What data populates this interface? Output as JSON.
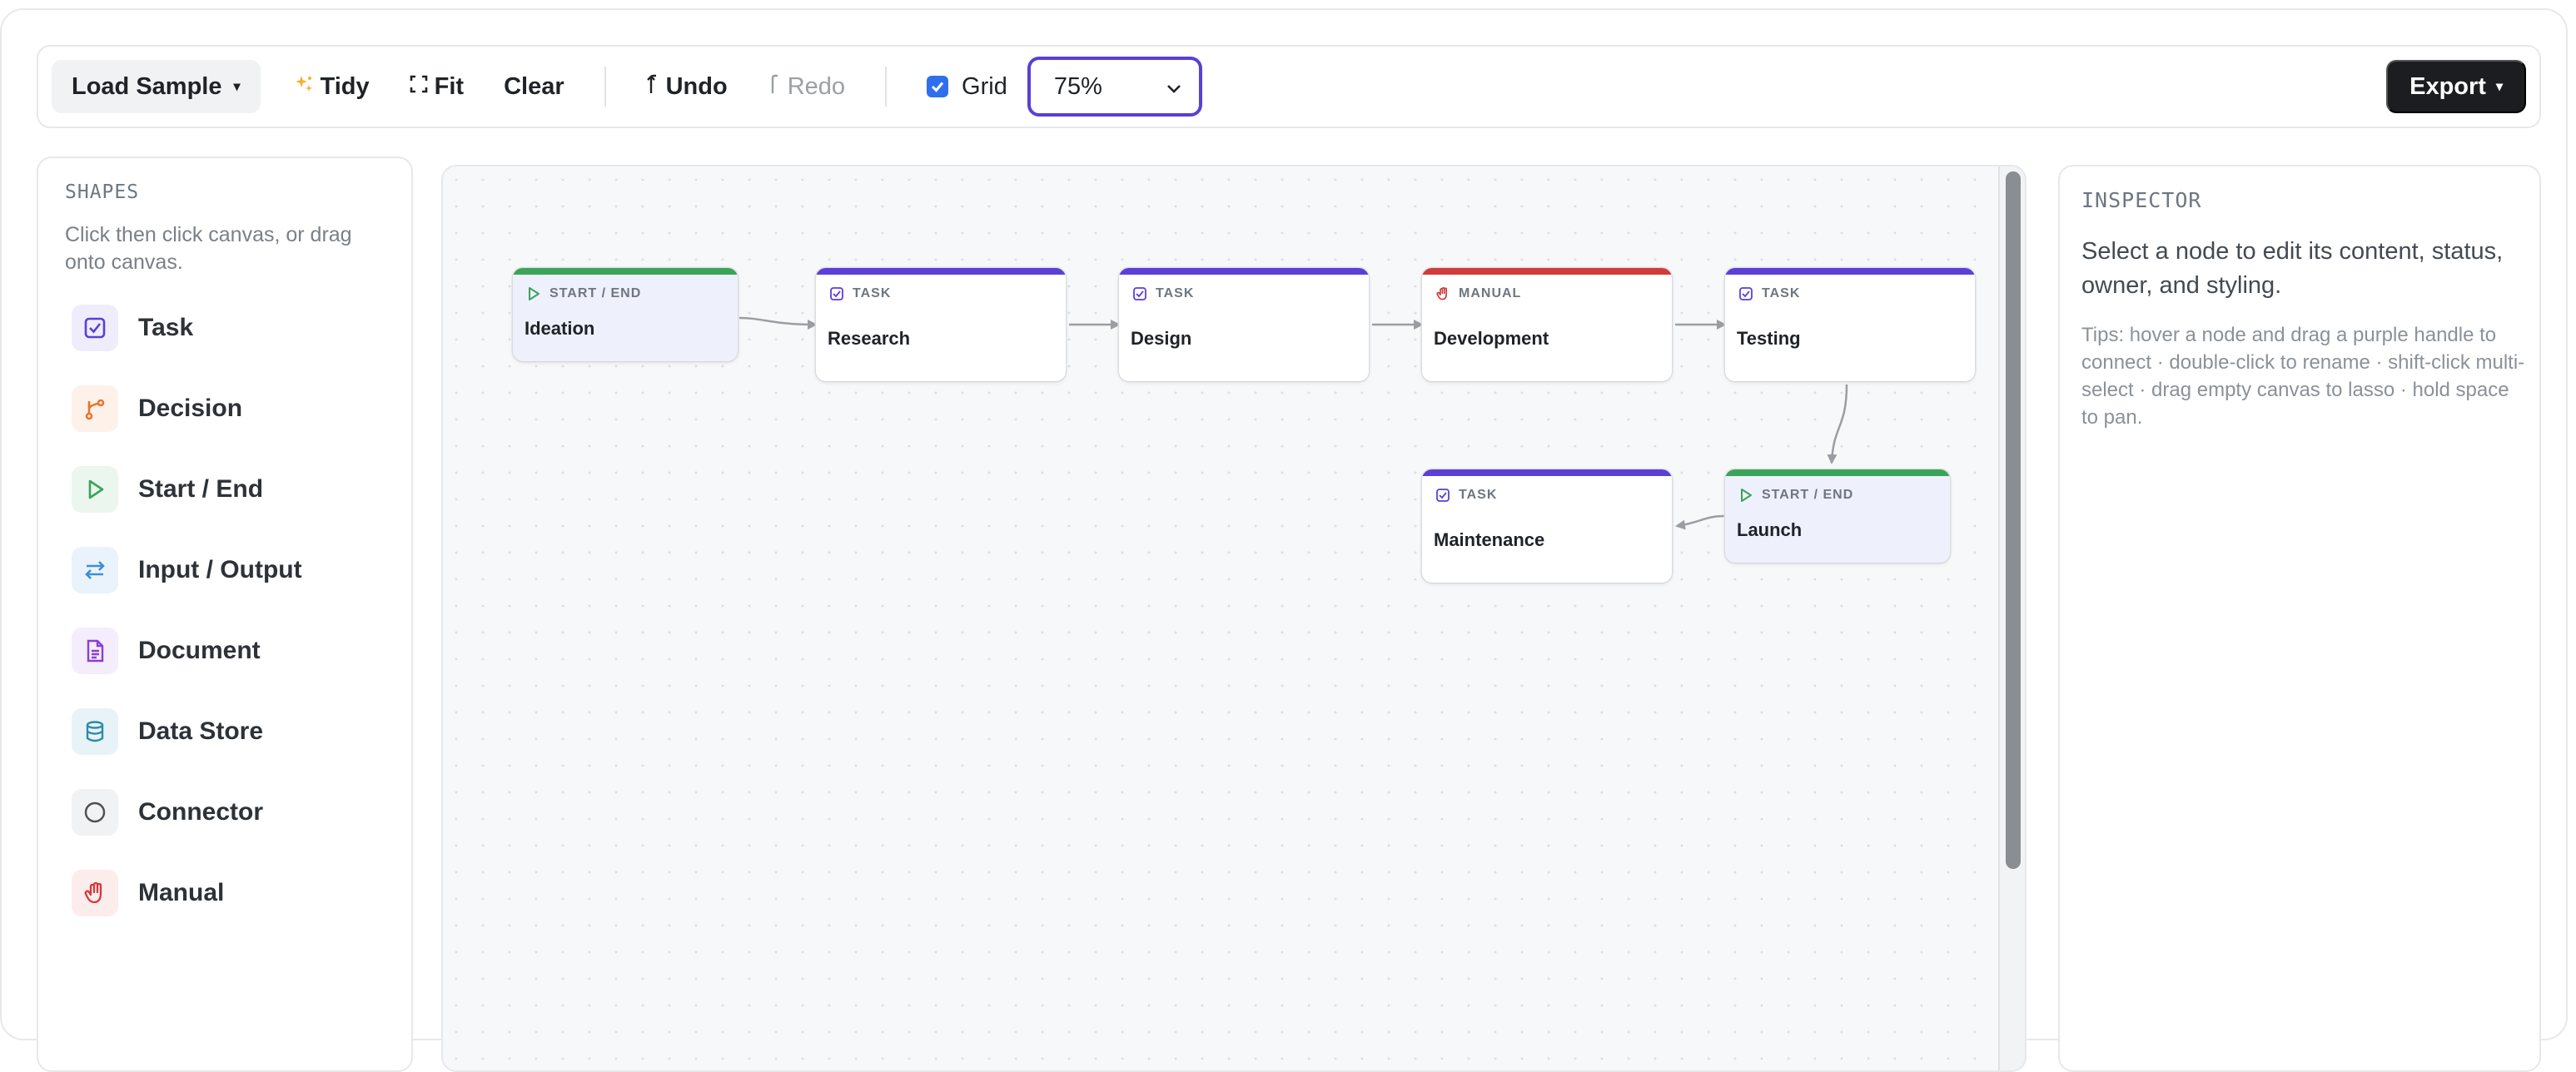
{
  "toolbar": {
    "load_sample_label": "Load Sample",
    "tidy_label": "Tidy",
    "fit_label": "Fit",
    "clear_label": "Clear",
    "undo_label": "Undo",
    "redo_label": "Redo",
    "grid_label": "Grid",
    "grid_enabled": true,
    "zoom_value": "75%",
    "export_label": "Export",
    "caret": "▾"
  },
  "shapes_panel": {
    "heading": "SHAPES",
    "hint": "Click then click canvas, or drag onto canvas.",
    "items": [
      {
        "label": "Task",
        "icon": "task-check-icon",
        "color": "#5b3fd6",
        "bg": "#efedfb"
      },
      {
        "label": "Decision",
        "icon": "branch-icon",
        "color": "#e8742c",
        "bg": "#fdf1e9"
      },
      {
        "label": "Start / End",
        "icon": "play-icon",
        "color": "#3ba35a",
        "bg": "#ebf6ee"
      },
      {
        "label": "Input / Output",
        "icon": "swap-arrows-icon",
        "color": "#3b8fd9",
        "bg": "#eaf3fc"
      },
      {
        "label": "Document",
        "icon": "document-icon",
        "color": "#8b3fd6",
        "bg": "#f4edfb"
      },
      {
        "label": "Data Store",
        "icon": "database-icon",
        "color": "#2d8aa8",
        "bg": "#e8f3f7"
      },
      {
        "label": "Connector",
        "icon": "circle-icon",
        "color": "#4a4f55",
        "bg": "#f1f2f4"
      },
      {
        "label": "Manual",
        "icon": "hand-icon",
        "color": "#d13b3b",
        "bg": "#fcecec"
      }
    ]
  },
  "canvas": {
    "nodes": [
      {
        "id": "ideation",
        "kind": "START / END",
        "title": "Ideation",
        "type": "start-end",
        "bar_color": "#3ba35a"
      },
      {
        "id": "research",
        "kind": "TASK",
        "title": "Research",
        "type": "task",
        "bar_color": "#5b3fd6"
      },
      {
        "id": "design",
        "kind": "TASK",
        "title": "Design",
        "type": "task",
        "bar_color": "#5b3fd6"
      },
      {
        "id": "development",
        "kind": "MANUAL",
        "title": "Development",
        "type": "manual",
        "bar_color": "#d13b3b"
      },
      {
        "id": "testing",
        "kind": "TASK",
        "title": "Testing",
        "type": "task",
        "bar_color": "#5b3fd6"
      },
      {
        "id": "launch",
        "kind": "START / END",
        "title": "Launch",
        "type": "start-end",
        "bar_color": "#3ba35a"
      },
      {
        "id": "maintenance",
        "kind": "TASK",
        "title": "Maintenance",
        "type": "task",
        "bar_color": "#5b3fd6"
      }
    ],
    "edge_color": "#9a9ea3"
  },
  "inspector": {
    "heading": "INSPECTOR",
    "message": "Select a node to edit its content, status, owner, and styling.",
    "tips": "Tips: hover a node and drag a purple handle to connect · double-click to rename · shift-click multi-select · drag empty canvas to lasso · hold space to pan."
  },
  "colors": {
    "accent": "#5b3fd6",
    "checkbox": "#2f6fed",
    "export_bg": "#1b1d20"
  }
}
